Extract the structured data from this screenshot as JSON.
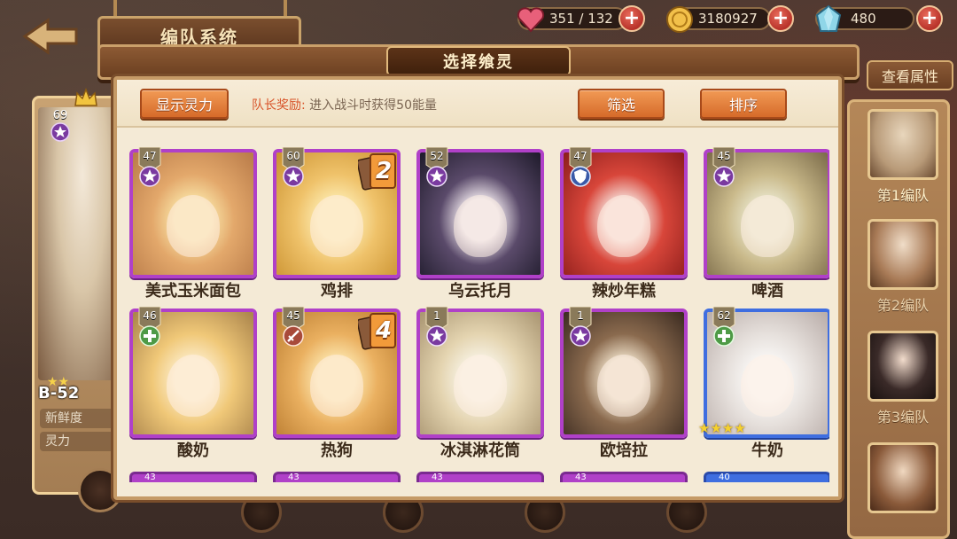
{
  "top_bar": {
    "title": "编队系统",
    "stamina": "351 / 132",
    "gold": "3180927",
    "gems": "480",
    "view_attr": "查看属性"
  },
  "left_panel": {
    "level": "69",
    "name": "B-52",
    "stat_1": "新鲜度",
    "stat_2": "灵力"
  },
  "team_panel": {
    "teams": [
      {
        "label": "第1编队"
      },
      {
        "label": "第2编队"
      },
      {
        "label": "第3编队"
      },
      {
        "label": ""
      }
    ]
  },
  "modal": {
    "title": "选择飨灵",
    "show_power_btn": "显示灵力",
    "leader_bonus_label": "队长奖励:",
    "leader_bonus_text": "进入战斗时获得50能量",
    "filter_btn": "筛选",
    "sort_btn": "排序"
  },
  "cards": [
    {
      "name": "美式玉米面包",
      "level": "47",
      "frame": "purple",
      "element": "star",
      "rank": "",
      "palette": [
        "#f7dda0",
        "#e3a86b",
        "#b87a48"
      ]
    },
    {
      "name": "鸡排",
      "level": "60",
      "frame": "purple",
      "element": "star",
      "rank": "2",
      "palette": [
        "#fbe6a8",
        "#efc26a",
        "#c9902e"
      ]
    },
    {
      "name": "乌云托月",
      "level": "52",
      "frame": "purple",
      "element": "star",
      "rank": "",
      "palette": [
        "#e8dfe6",
        "#5a4a6a",
        "#1e1a2a"
      ]
    },
    {
      "name": "辣炒年糕",
      "level": "47",
      "frame": "purple",
      "element": "shield",
      "rank": "",
      "palette": [
        "#f4d6cf",
        "#d8463a",
        "#8a1c1a"
      ]
    },
    {
      "name": "啤酒",
      "level": "45",
      "frame": "purple",
      "element": "star",
      "rank": "",
      "palette": [
        "#e6e2c6",
        "#c9b98a",
        "#7a6a48"
      ]
    },
    {
      "name": "酸奶",
      "level": "46",
      "frame": "purple",
      "element": "heal",
      "rank": "",
      "palette": [
        "#fbe8c0",
        "#f0c878",
        "#a8824a"
      ]
    },
    {
      "name": "热狗",
      "level": "45",
      "frame": "purple",
      "element": "sword",
      "rank": "4",
      "palette": [
        "#fbe2a8",
        "#eab060",
        "#b87a2e"
      ]
    },
    {
      "name": "冰淇淋花筒",
      "level": "1",
      "frame": "purple",
      "element": "star",
      "rank": "",
      "palette": [
        "#f6f0e0",
        "#e4d4b0",
        "#a89470"
      ]
    },
    {
      "name": "欧培拉",
      "level": "1",
      "frame": "purple",
      "element": "star",
      "rank": "",
      "palette": [
        "#e8d8c0",
        "#8a6a4e",
        "#3a2a20"
      ]
    },
    {
      "name": "牛奶",
      "level": "62",
      "frame": "blue",
      "element": "heal",
      "rank": "",
      "stars": "★★★★",
      "palette": [
        "#f8f6f4",
        "#e6e0dc",
        "#b8aca8"
      ]
    }
  ],
  "partial_cards_levels": [
    "43",
    "43",
    "43",
    "43",
    "40"
  ],
  "colors": {
    "accent_orange": "#e07a35",
    "frame_purple": "#b040c8",
    "frame_blue": "#3f6ee0",
    "bonus_red": "#d8542a"
  }
}
